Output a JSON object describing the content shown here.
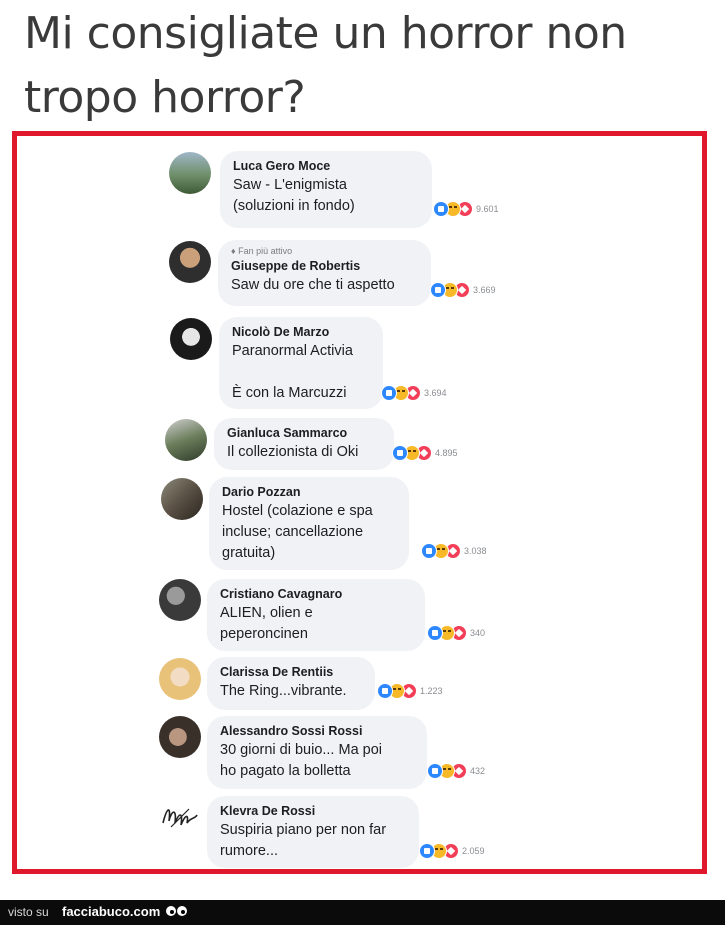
{
  "post": {
    "title": "Mi consigliate un horror non tropo horror?"
  },
  "comments": [
    {
      "author": "Luca Gero Moce",
      "badge": "",
      "text": "Saw - L'enigmista\n(soluzioni in fondo)",
      "reaction_count": "9.601"
    },
    {
      "author": "Giuseppe de Robertis",
      "badge": "Fan più attivo",
      "text": "Saw du ore che ti aspetto",
      "reaction_count": "3.669"
    },
    {
      "author": "Nicolò De Marzo",
      "badge": "",
      "text": "Paranormal Activia\n\nÈ con la Marcuzzi",
      "reaction_count": "3.694"
    },
    {
      "author": "Gianluca Sammarco",
      "badge": "",
      "text": "Il collezionista di Oki",
      "reaction_count": "4.895"
    },
    {
      "author": "Dario Pozzan",
      "badge": "",
      "text": "Hostel (colazione e spa\nincluse; cancellazione\ngratuita)",
      "reaction_count": "3.038"
    },
    {
      "author": "Cristiano Cavagnaro",
      "badge": "",
      "text": "ALIEN, olien e\npeperoncinen",
      "reaction_count": "340"
    },
    {
      "author": "Clarissa De Rentiis",
      "badge": "",
      "text": "The Ring...vibrante.",
      "reaction_count": "1.223"
    },
    {
      "author": "Alessandro Sossi Rossi",
      "badge": "",
      "text": "30 giorni di buio... Ma poi\nho pagato la bolletta",
      "reaction_count": "432"
    },
    {
      "author": "Klevra De Rossi",
      "badge": "",
      "text": "Suspiria piano per non far\nrumore...",
      "reaction_count": "2.059"
    }
  ],
  "reaction_icons": [
    "like-icon",
    "haha-icon",
    "love-icon"
  ],
  "colors": {
    "frame": "#e0182b",
    "like": "#2d88ff",
    "haha": "#f7b928",
    "love": "#f33e58",
    "bubble": "#f0f2f5"
  },
  "footer": {
    "visto_label": "visto su",
    "site_label": "facciabuco.com"
  }
}
